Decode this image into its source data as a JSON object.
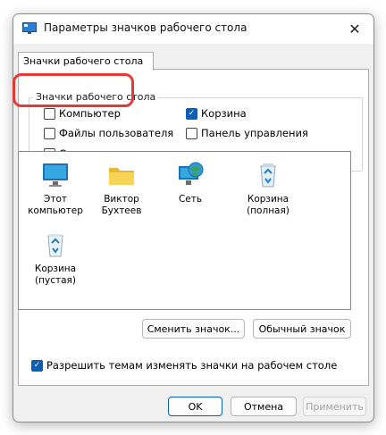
{
  "window": {
    "title": "Параметры значков рабочего стола",
    "close_symbol": "✕"
  },
  "tab": {
    "label": "Значки рабочего стола"
  },
  "group": {
    "legend": "Значки рабочего стола"
  },
  "checkboxes": [
    {
      "label": "Компьютер",
      "checked": false
    },
    {
      "label": "Корзина",
      "checked": true
    },
    {
      "label": "Файлы пользователя",
      "checked": false
    },
    {
      "label": "Панель управления",
      "checked": false
    },
    {
      "label": "Сеть",
      "checked": false
    }
  ],
  "icons": [
    {
      "line1": "Этот",
      "line2": "компьютер",
      "icon": "monitor-icon"
    },
    {
      "line1": "Виктор",
      "line2": "Бухтеев",
      "icon": "folder-icon"
    },
    {
      "line1": "Сеть",
      "line2": "",
      "icon": "network-globe-icon"
    },
    {
      "line1": "Корзина",
      "line2": "(полная)",
      "icon": "recycle-bin-full-icon"
    },
    {
      "line1": "Корзина",
      "line2": "(пустая)",
      "icon": "recycle-bin-empty-icon"
    }
  ],
  "buttons": {
    "change_icon": "Сменить значок...",
    "default_icon": "Обычный значок",
    "ok": "OK",
    "cancel": "Отмена",
    "apply": "Применить"
  },
  "theme_checkbox": {
    "label": "Разрешить темам изменять значки на рабочем столе",
    "checked": true
  },
  "colors": {
    "accent": "#0a5fb4",
    "highlight": "#e53935"
  }
}
